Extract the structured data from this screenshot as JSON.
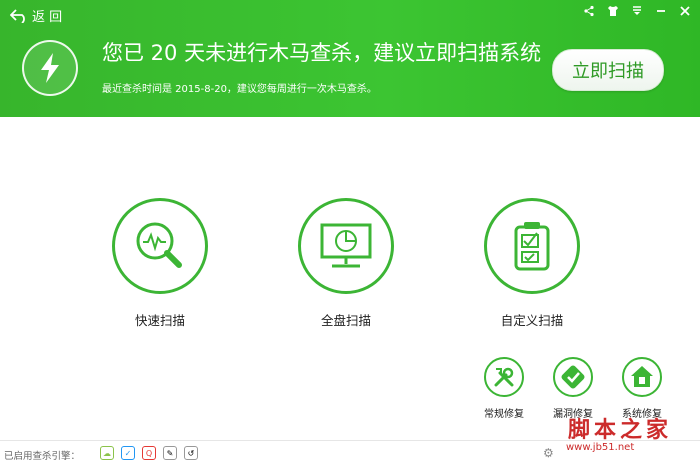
{
  "header": {
    "back_label": "返 回",
    "title": "您已 20 天未进行木马查杀，建议立即扫描系统",
    "subtitle": "最近查杀时间是 2015-8-20，建议您每周进行一次木马查杀。",
    "scan_button": "立即扫描"
  },
  "top_icons": [
    "share-icon",
    "shirt-icon",
    "menu-icon",
    "minimize-icon",
    "close-icon"
  ],
  "scan_modes": [
    {
      "label": "快速扫描",
      "icon": "quick-scan-icon"
    },
    {
      "label": "全盘扫描",
      "icon": "full-scan-icon"
    },
    {
      "label": "自定义扫描",
      "icon": "custom-scan-icon"
    }
  ],
  "tools": [
    {
      "label": "常规修复",
      "icon": "wrench-icon"
    },
    {
      "label": "漏洞修复",
      "icon": "patch-icon"
    },
    {
      "label": "系统修复",
      "icon": "shield-home-icon"
    }
  ],
  "footer": {
    "engines_label": "已启用查杀引擎："
  },
  "watermark": {
    "text": "脚本之家",
    "url": "www.jb51.net"
  },
  "colors": {
    "accent": "#3cb535",
    "header_green": "#3cc532"
  }
}
